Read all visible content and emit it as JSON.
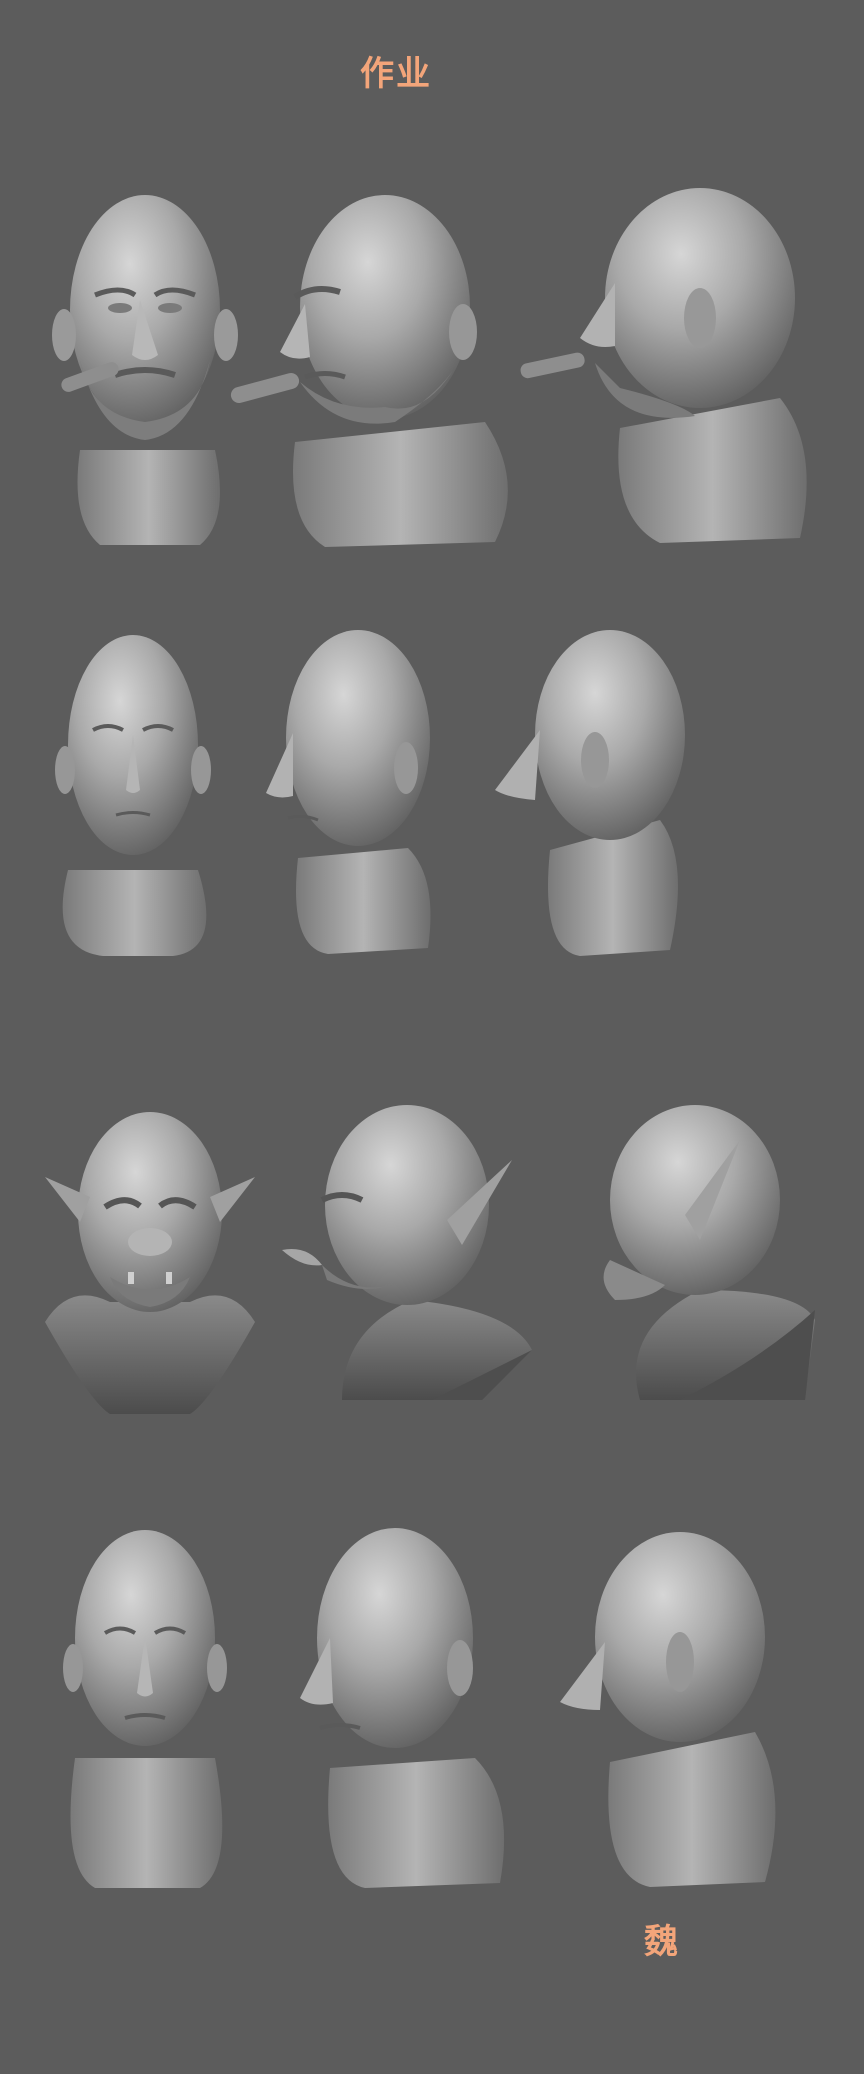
{
  "sheet": {
    "title": "作业",
    "signature": "魏",
    "background_color": "#5c5c5c",
    "accent_color": "#f3a57a"
  },
  "rows": [
    {
      "subject": "bald-man-with-cigar-and-beard",
      "views": [
        "front",
        "three-quarter",
        "profile"
      ]
    },
    {
      "subject": "bald-gaunt-man",
      "views": [
        "front",
        "three-quarter",
        "profile"
      ]
    },
    {
      "subject": "orc-with-tusks",
      "views": [
        "front",
        "three-quarter",
        "profile"
      ]
    },
    {
      "subject": "bald-muscular-man",
      "views": [
        "front",
        "three-quarter",
        "profile"
      ]
    }
  ]
}
